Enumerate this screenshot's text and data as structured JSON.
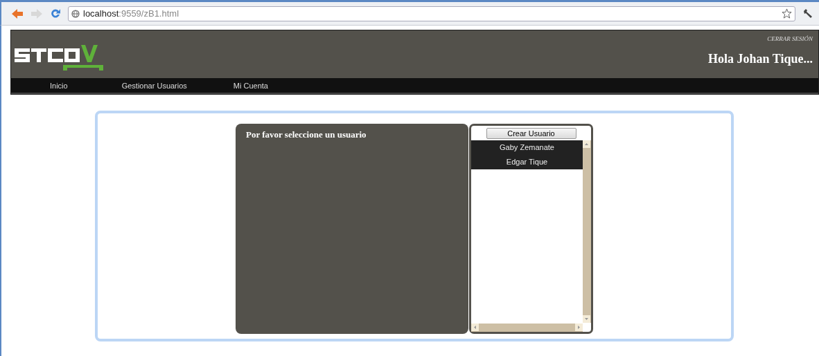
{
  "browser": {
    "url_host": "localhost",
    "url_rest": ":9559/zB1.html"
  },
  "header": {
    "logout": "CERRAR SESIÓN",
    "greeting": "Hola Johan Tique..."
  },
  "nav": [
    {
      "label": "Inicio"
    },
    {
      "label": "Gestionar Usuarios"
    },
    {
      "label": "Mi Cuenta"
    }
  ],
  "main": {
    "message": "Por favor seleccione un usuario",
    "create_button": "Crear Usuario",
    "users": [
      {
        "name": "Gaby Zemanate"
      },
      {
        "name": "Edgar Tique"
      }
    ]
  }
}
